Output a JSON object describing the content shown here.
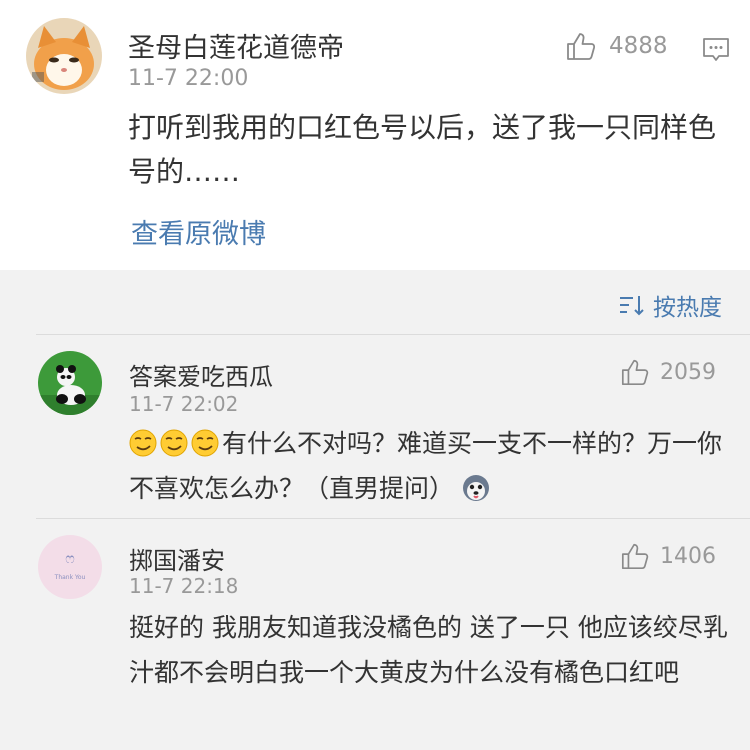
{
  "main_comment": {
    "username": "圣母白莲花道德帝",
    "timestamp": "11-7 22:00",
    "likes": "4888",
    "text": "打听到我用的口红色号以后，送了我一只同样色号的……",
    "view_original": "查看原微博",
    "icons": {
      "like": "thumbs-up-icon",
      "comment": "comment-icon"
    }
  },
  "sort": {
    "label": "按热度",
    "icon": "sort-icon"
  },
  "replies": [
    {
      "username": "答案爱吃西瓜",
      "timestamp": "11-7 22:02",
      "likes": "2059",
      "text": "有什么不对吗？难道买一支不一样的？万一你不喜欢怎么办？（直男提问）",
      "leading_emojis": [
        "smirk-emoji",
        "smirk-emoji",
        "smirk-emoji"
      ],
      "trailing_emoji": "husky-emoji"
    },
    {
      "username": "掷国潘安",
      "timestamp": "11-7 22:18",
      "likes": "1406",
      "text": "挺好的 我朋友知道我没橘色的 送了一只 他应该绞尽乳汁都不会明白我一个大黄皮为什么没有橘色口红吧",
      "avatar_caption": "Thank You"
    }
  ],
  "colors": {
    "link": "#4a7bb0",
    "meta": "#999999",
    "text": "#333333",
    "background": "#f2f2f2",
    "card": "#ffffff"
  }
}
